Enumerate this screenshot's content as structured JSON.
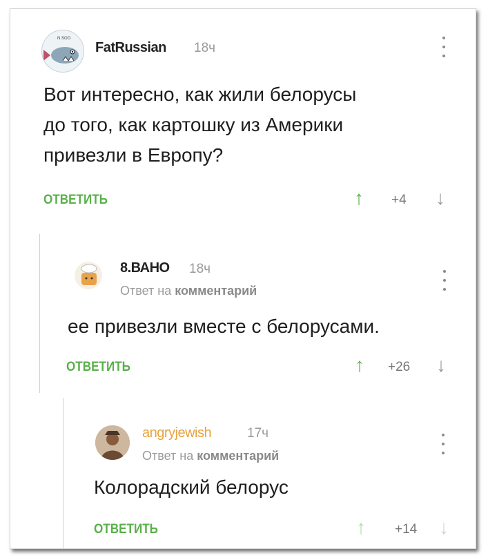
{
  "comments": [
    {
      "username": "FatRussian",
      "time": "18ч",
      "text_lines": [
        "Вот интересно, как жили белорусы",
        "до того, как картошку из Америки",
        "привезли в Европу?"
      ],
      "reply_label": "ОТВЕТИТЬ",
      "votes": "+4",
      "avatar_caption": "N.SOO"
    },
    {
      "username": "8.ВАНО",
      "time": "18ч",
      "reply_meta_prefix": "Ответ на",
      "reply_meta_link": "комментарий",
      "text_lines": [
        "ее привезли вместе с белорусами."
      ],
      "reply_label": "ОТВЕТИТЬ",
      "votes": "+26"
    },
    {
      "username": "angryjewish",
      "time": "17ч",
      "reply_meta_prefix": "Ответ на",
      "reply_meta_link": "комментарий",
      "text_lines": [
        "Колорадский белорус"
      ],
      "reply_label": "ОТВЕТИТЬ",
      "votes": "+14"
    }
  ],
  "icons": {
    "upvote": "arrow-up-icon",
    "downvote": "arrow-down-icon",
    "menu": "more-vertical-icon"
  },
  "colors": {
    "accent_green": "#59b04a",
    "muted_gray": "#9a9a9a",
    "username_angryjewish": "#e8a33c"
  }
}
